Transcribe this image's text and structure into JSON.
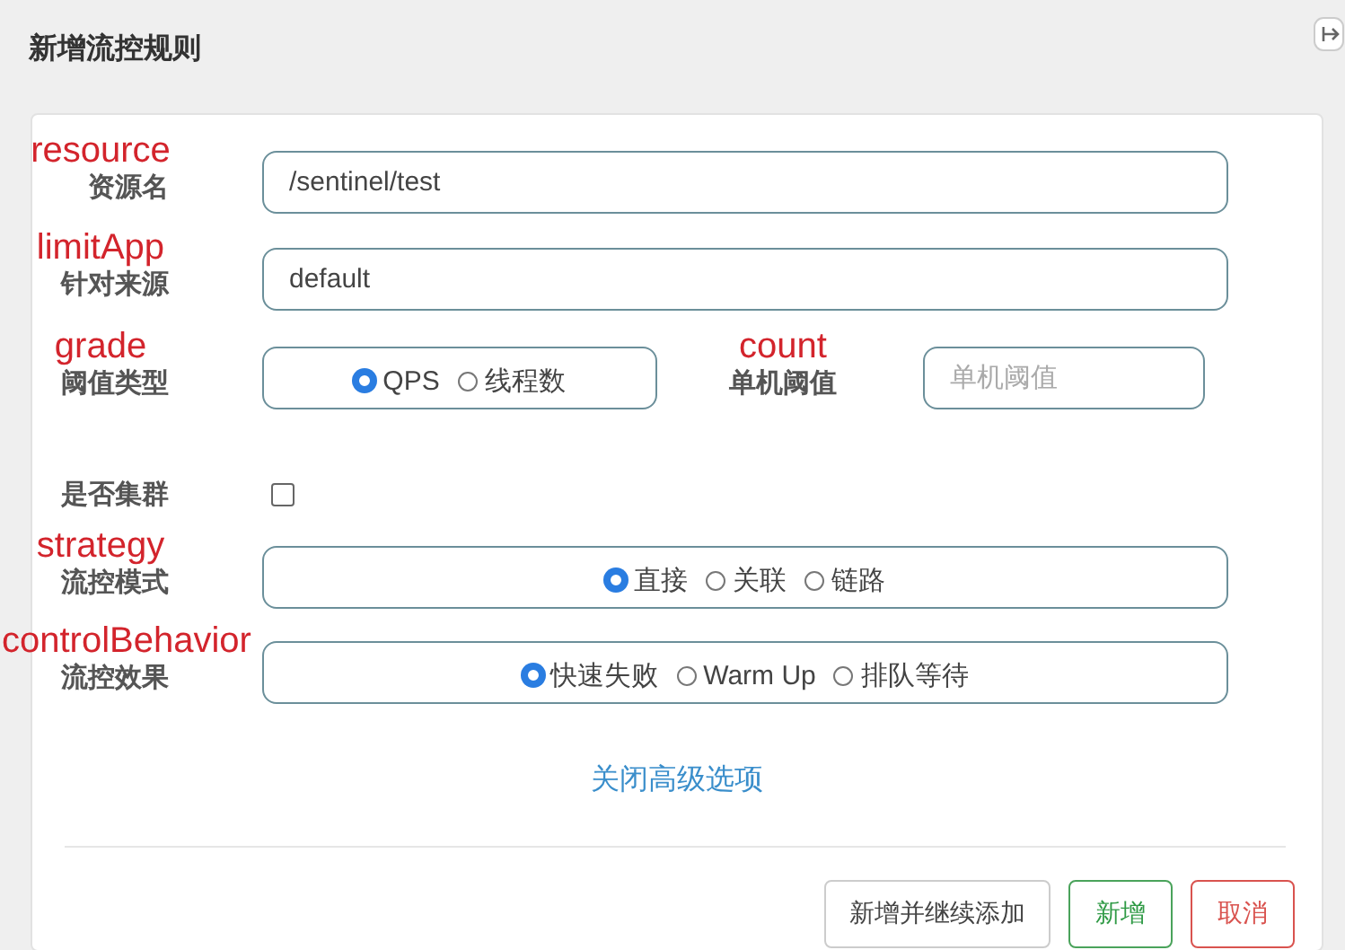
{
  "dialog": {
    "title": "新增流控规则"
  },
  "rows": [
    {
      "kind": "input",
      "annotation": "resource",
      "label": "资源名",
      "value": "/sentinel/test"
    },
    {
      "kind": "input",
      "annotation": "limitApp",
      "label": "针对来源",
      "value": "default"
    },
    {
      "kind": "radio_side",
      "annotation": "grade",
      "label": "阈值类型",
      "options": [
        {
          "label": "QPS",
          "selected": true
        },
        {
          "label": "线程数",
          "selected": false
        }
      ],
      "side": {
        "annotation": "count",
        "label": "单机阈值",
        "placeholder": "单机阈值"
      }
    },
    {
      "kind": "checkbox",
      "label": "是否集群",
      "checked": false
    },
    {
      "kind": "radio",
      "annotation": "strategy",
      "label": "流控模式",
      "options": [
        {
          "label": "直接",
          "selected": true
        },
        {
          "label": "关联",
          "selected": false
        },
        {
          "label": "链路",
          "selected": false
        }
      ]
    },
    {
      "kind": "radio",
      "annotation": "controlBehavior",
      "label": "流控效果",
      "options": [
        {
          "label": "快速失败",
          "selected": true
        },
        {
          "label": "Warm Up",
          "selected": false
        },
        {
          "label": "排队等待",
          "selected": false
        }
      ]
    }
  ],
  "advanced_link": "关闭高级选项",
  "buttons": [
    {
      "label": "新增并继续添加",
      "kind": "default"
    },
    {
      "label": "新增",
      "kind": "success"
    },
    {
      "label": "取消",
      "kind": "danger"
    }
  ]
}
